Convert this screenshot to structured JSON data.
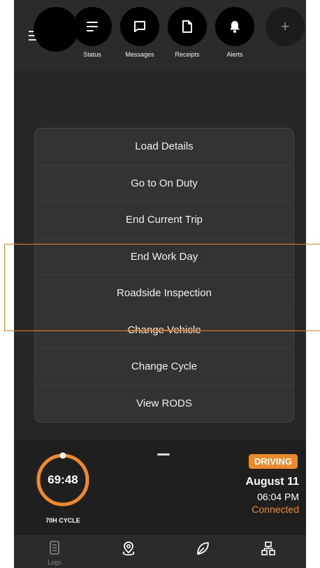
{
  "header": {
    "actions": [
      {
        "label": "Status",
        "icon": "lines-icon"
      },
      {
        "label": "Messages",
        "icon": "chat-icon"
      },
      {
        "label": "Receipts",
        "icon": "document-icon"
      },
      {
        "label": "Alerts",
        "icon": "bell-icon"
      },
      {
        "label": "",
        "icon": "plus-icon"
      }
    ],
    "add_symbol": "+"
  },
  "menu": {
    "items": [
      "Load Details",
      "Go to On Duty",
      "End Current Trip",
      "End Work Day",
      "Roadside Inspection",
      "Change Vehicle",
      "Change Cycle",
      "View RODS"
    ]
  },
  "status": {
    "clock": "69:48",
    "cycle": "70H CYCLE",
    "state": "DRIVING",
    "date": "August 11",
    "time": "06:04 PM",
    "connection": "Connected"
  },
  "nav": {
    "items": [
      {
        "label": "Logs",
        "icon": "logs-icon"
      },
      {
        "label": "",
        "icon": "map-pin-icon"
      },
      {
        "label": "",
        "icon": "leaf-icon"
      },
      {
        "label": "",
        "icon": "network-icon"
      }
    ]
  },
  "colors": {
    "accent": "#ee8a29",
    "background": "#272727",
    "menu_background": "#333333"
  }
}
